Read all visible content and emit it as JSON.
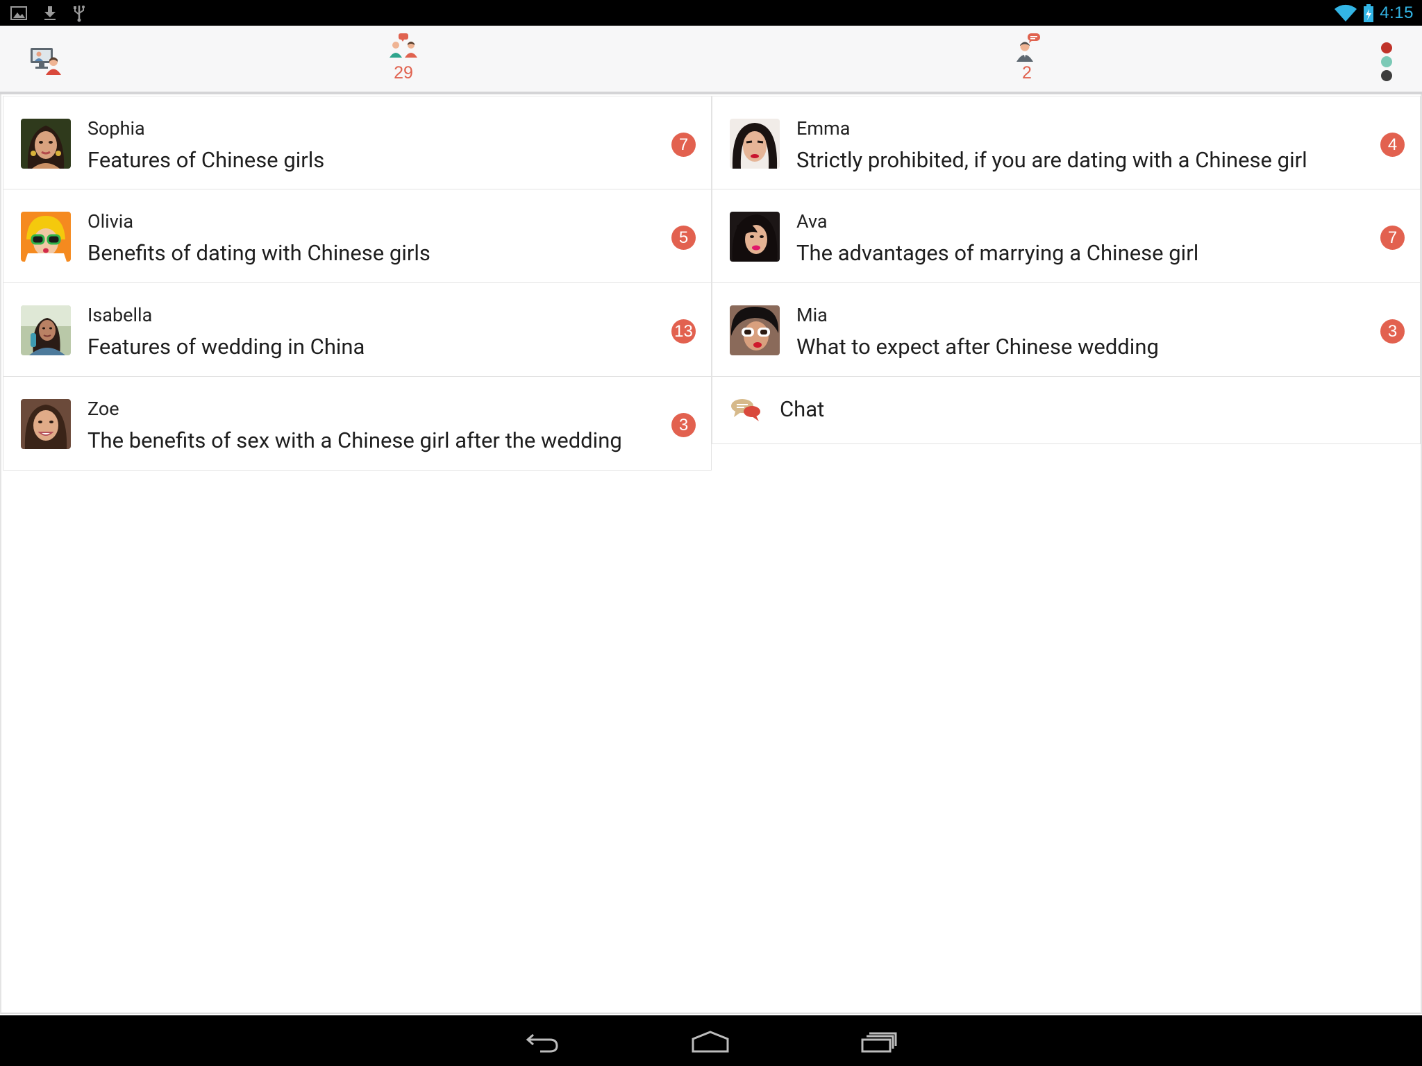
{
  "status_bar": {
    "left_icons": [
      "image-notification-icon",
      "download-notification-icon",
      "usb-icon"
    ],
    "right_icons": [
      "wifi-icon",
      "battery-charging-icon"
    ],
    "time": "4:15",
    "accent": "#33b5e5"
  },
  "action_bar": {
    "logo_icon": "monitor-people-icon",
    "tabs": [
      {
        "icon": "group-chat-icon",
        "count": "29"
      },
      {
        "icon": "private-chat-icon",
        "count": "2"
      }
    ],
    "menu_icon": "traffic-dots-menu-icon",
    "accent": "#e0624f"
  },
  "rooms": {
    "left": [
      {
        "author": "Sophia",
        "topic": "Features of Chinese girls",
        "badge": "7"
      },
      {
        "author": "Olivia",
        "topic": "Benefits of dating with Chinese girls",
        "badge": "5"
      },
      {
        "author": "Isabella",
        "topic": "Features of wedding in China",
        "badge": "13"
      },
      {
        "author": "Zoe",
        "topic": "The benefits of sex with a Chinese girl after the wedding",
        "badge": "3"
      }
    ],
    "right": [
      {
        "author": "Emma",
        "topic": "Strictly prohibited, if you are dating with a Chinese girl",
        "badge": "4"
      },
      {
        "author": "Ava",
        "topic": "The advantages of marrying a Chinese girl",
        "badge": "7"
      },
      {
        "author": "Mia",
        "topic": "What to expect after Chinese wedding",
        "badge": "3"
      }
    ],
    "chat": {
      "label": "Chat",
      "icon": "speech-bubbles-icon"
    }
  },
  "nav_bar": {
    "buttons": [
      "back-icon",
      "home-icon",
      "recents-icon"
    ]
  }
}
